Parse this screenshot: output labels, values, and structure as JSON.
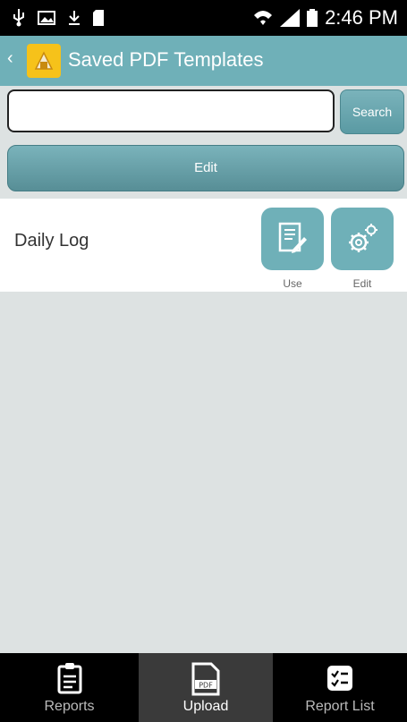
{
  "status": {
    "time": "2:46 PM"
  },
  "appbar": {
    "back_icon": "chevron-left-icon",
    "title": "Saved PDF Templates"
  },
  "search": {
    "value": "",
    "placeholder": "",
    "button_label": "Search"
  },
  "toolbar": {
    "edit_label": "Edit"
  },
  "templates": [
    {
      "name": "Daily Log",
      "use_label": "Use",
      "edit_label": "Edit"
    }
  ],
  "bottom_nav": [
    {
      "label": "Reports",
      "icon": "clipboard-icon"
    },
    {
      "label": "Upload",
      "icon": "pdf-file-icon"
    },
    {
      "label": "Report List",
      "icon": "checklist-icon"
    }
  ],
  "colors": {
    "accent": "#6fb0b8",
    "background": "#dde2e2"
  }
}
